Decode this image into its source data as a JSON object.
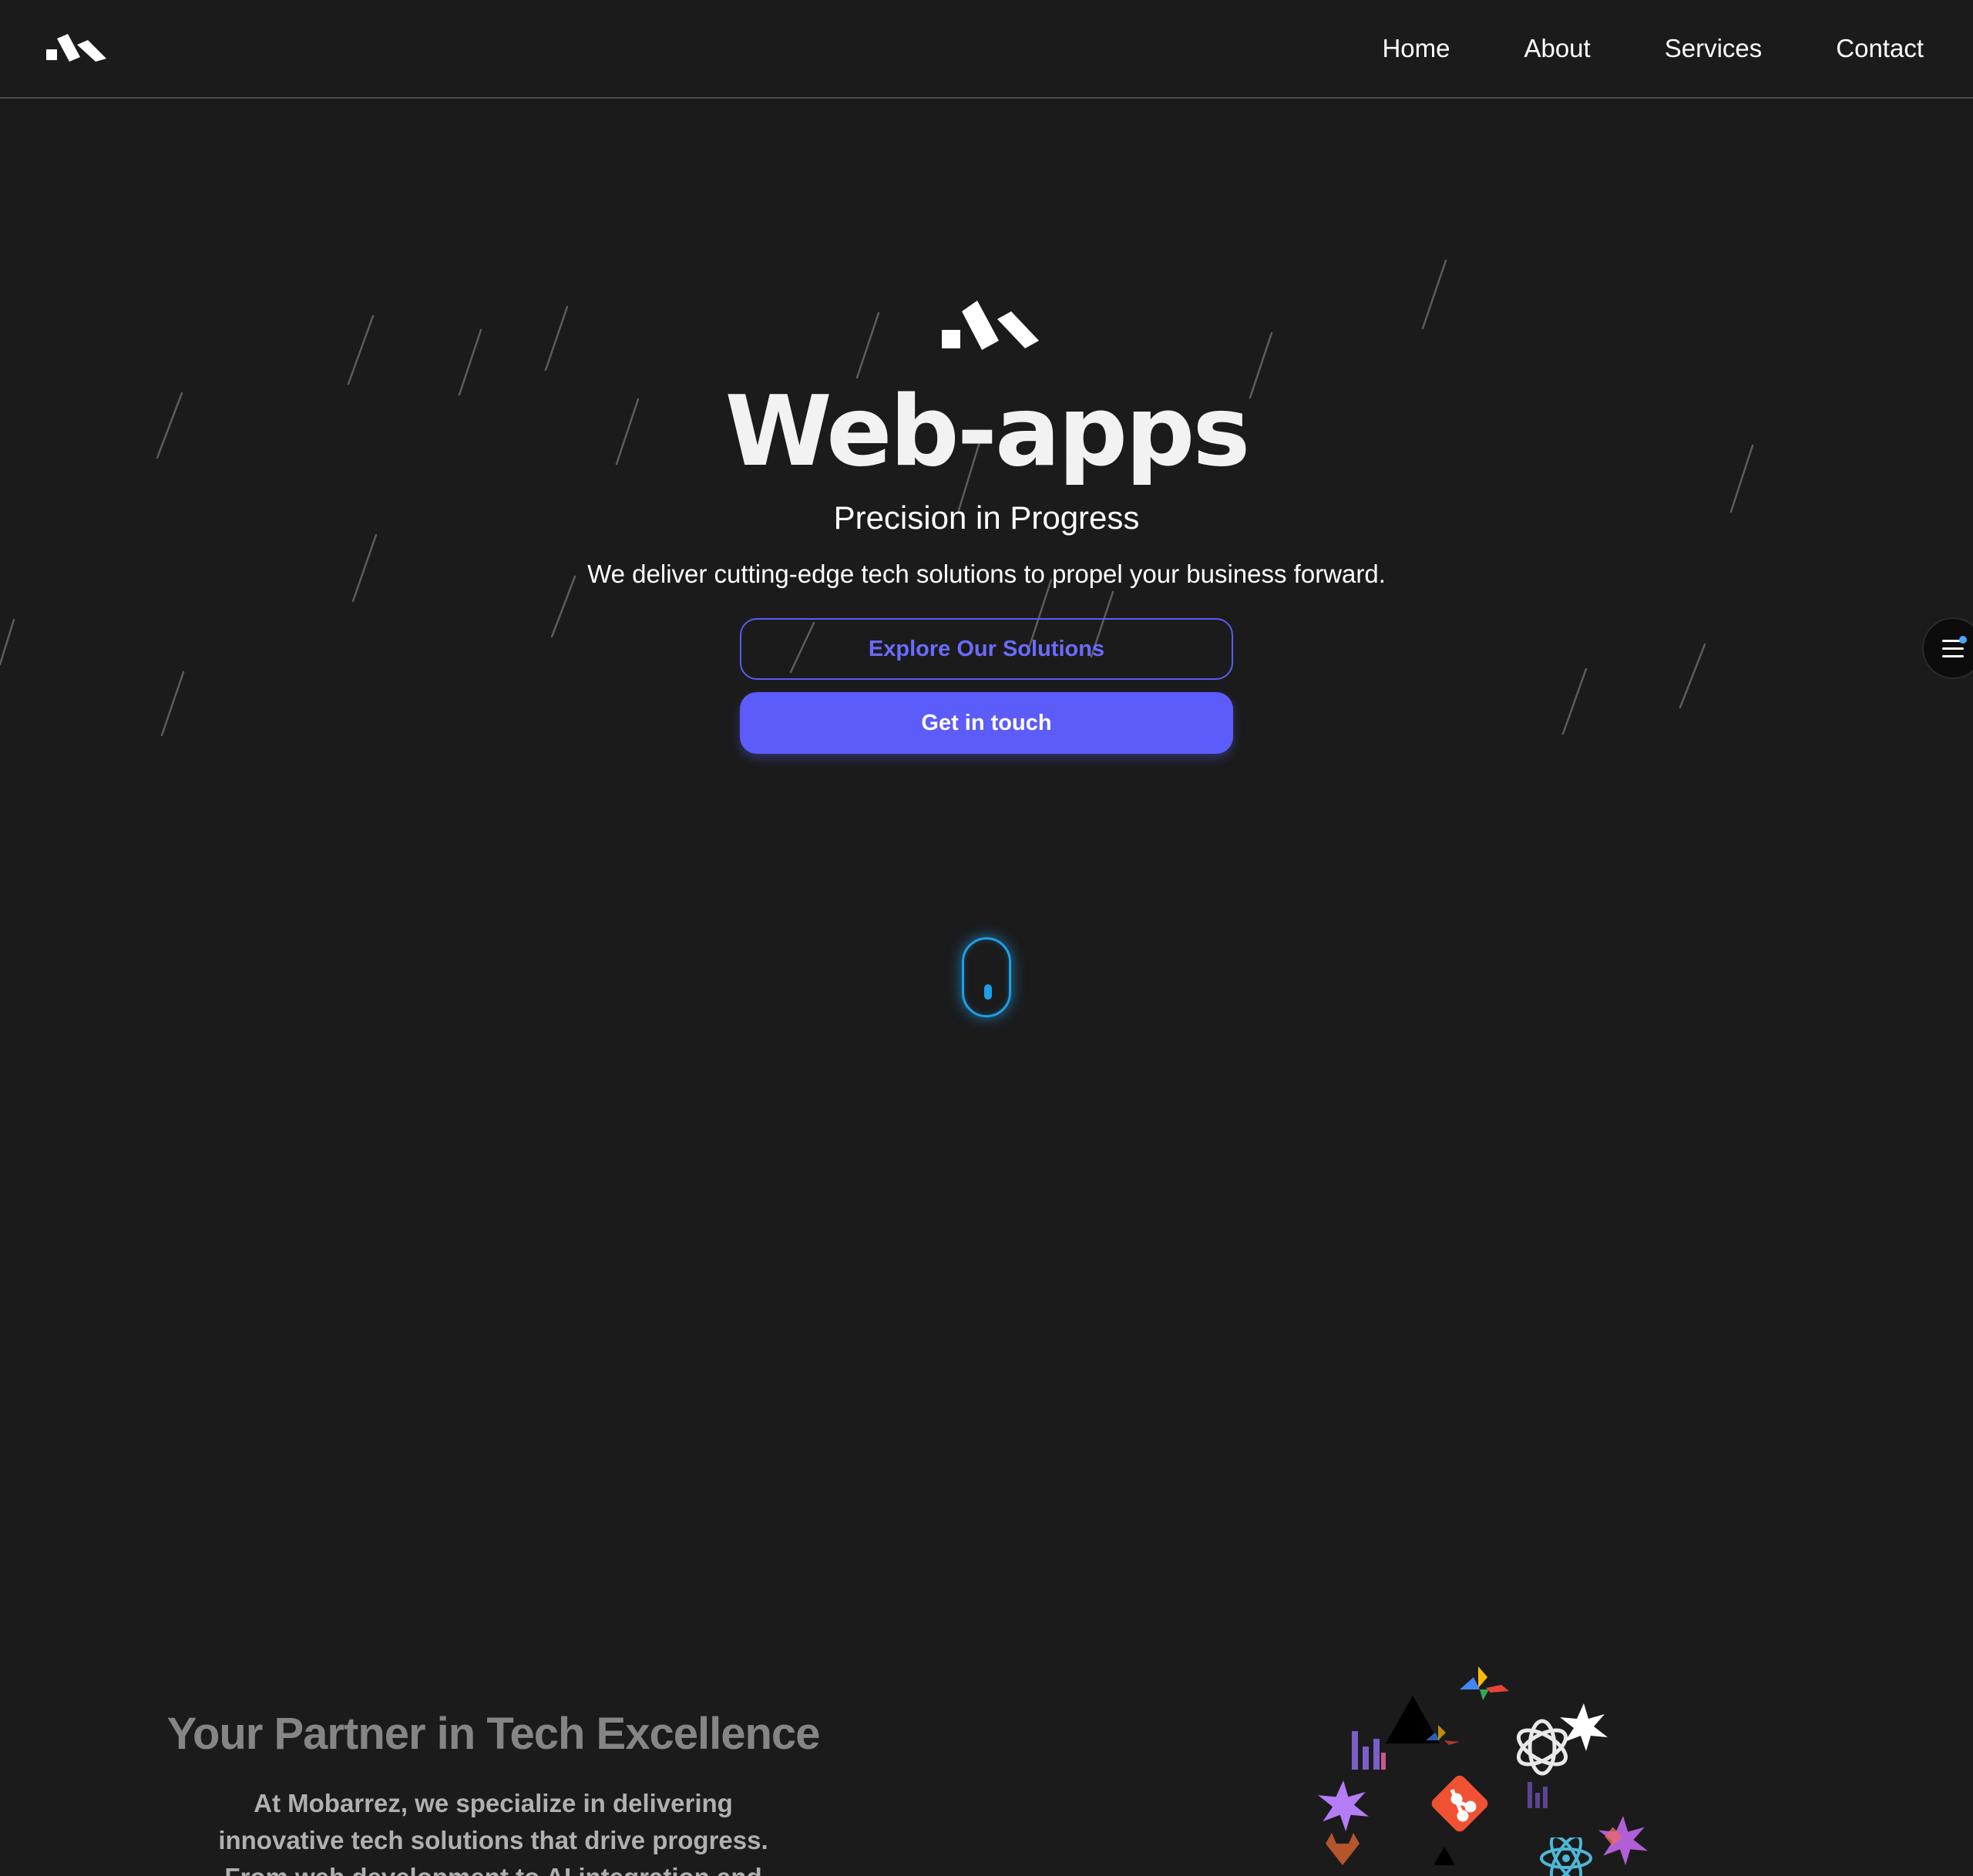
{
  "header": {
    "nav": [
      {
        "label": "Home"
      },
      {
        "label": "About"
      },
      {
        "label": "Services"
      },
      {
        "label": "Contact"
      }
    ]
  },
  "hero": {
    "title": "Web-apps",
    "subtitle": "Precision in Progress",
    "description": "We deliver cutting-edge tech solutions to propel your business forward.",
    "primary_button": "Explore Our Solutions",
    "secondary_button": "Get in touch"
  },
  "about": {
    "title": "Your Partner in Tech Excellence",
    "text_line1": "At Mobarrez, we specialize in delivering",
    "text_line2": "innovative tech solutions that drive progress.",
    "text_line3": "From web development to AI integration and"
  },
  "colors": {
    "background": "#1b1b1c",
    "accent": "#5c5cfa",
    "scroll_indicator": "#1da0e6"
  },
  "icons": {
    "logo": "brand-logo-icon",
    "menu": "menu-icon",
    "scroll": "scroll-mouse-icon",
    "tech": [
      "bar-chart-icon",
      "triangle-icon",
      "google-cloud-icon",
      "openai-icon",
      "sparkle-icon",
      "git-icon",
      "gitlab-icon",
      "react-icon"
    ]
  }
}
